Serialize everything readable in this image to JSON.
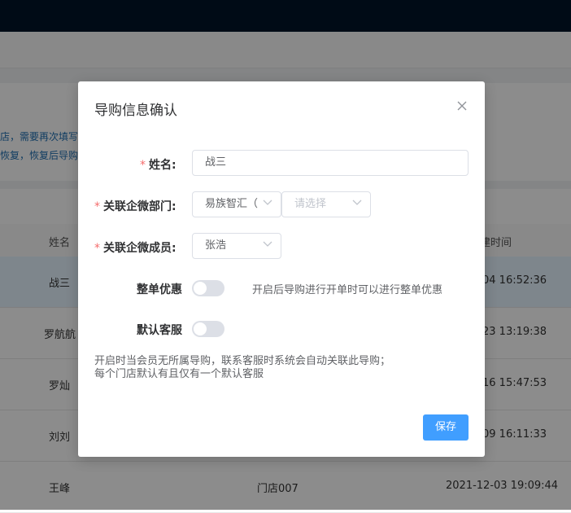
{
  "background": {
    "notice_lines": [
      "店，需要再次填写",
      "恢复，恢复后导购"
    ],
    "table": {
      "headers": [
        "姓名",
        "建时间"
      ],
      "rows": [
        {
          "name": "战三",
          "store": "",
          "time": "04 16:52:36"
        },
        {
          "name": "罗航航",
          "store": "",
          "time": "23 13:19:38"
        },
        {
          "name": "罗灿",
          "store": "",
          "time": "16 15:47:53"
        },
        {
          "name": "刘刘",
          "store": "",
          "time": "09 16:11:33"
        },
        {
          "name": "王峰",
          "store": "门店007",
          "time": "2021-12-03 19:09:44"
        }
      ]
    }
  },
  "modal": {
    "title": "导购信息确认",
    "name_label": "姓名:",
    "name_value": "战三",
    "dept_label": "关联企微部门:",
    "dept_value": "易族智汇（",
    "dept_sub_placeholder": "请选择",
    "member_label": "关联企微成员:",
    "member_value": "张浩",
    "discount_label": "整单优惠",
    "discount_on": false,
    "discount_hint": "开启后导购进行开单时可以进行整单优惠",
    "default_service_label": "默认客服",
    "default_service_on": false,
    "note_line1": "开启时当会员无所属导购，联系客服时系统会自动关联此导购；",
    "note_line2": "每个门店默认有且仅有一个默认客服",
    "save_label": "保存",
    "required_mark": "*"
  },
  "colors": {
    "topbar": "#001529",
    "primary": "#409eff",
    "required": "#f56c6c",
    "row_highlight": "#e6f4ff"
  },
  "icons": [
    "close-icon",
    "chevron-down-icon"
  ]
}
